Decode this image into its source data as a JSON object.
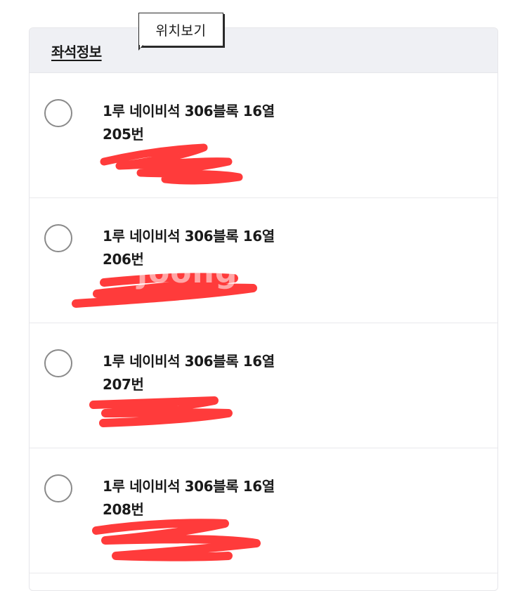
{
  "header": {
    "title": "좌석정보",
    "location_tooltip": "위치보기"
  },
  "seats": [
    {
      "line1": "1루 네이비석 306블록 16열",
      "line2": "205번",
      "selected": false
    },
    {
      "line1": "1루 네이비석 306블록 16열",
      "line2": "206번",
      "selected": false
    },
    {
      "line1": "1루 네이비석 306블록 16열",
      "line2": "207번",
      "selected": false
    },
    {
      "line1": "1루 네이비석 306블록 16열",
      "line2": "208번",
      "selected": false
    }
  ],
  "watermark": "joong",
  "colors": {
    "header_bg": "#eff0f4",
    "redaction": "#ff3b3b",
    "radio_border": "#8a8a8a"
  }
}
